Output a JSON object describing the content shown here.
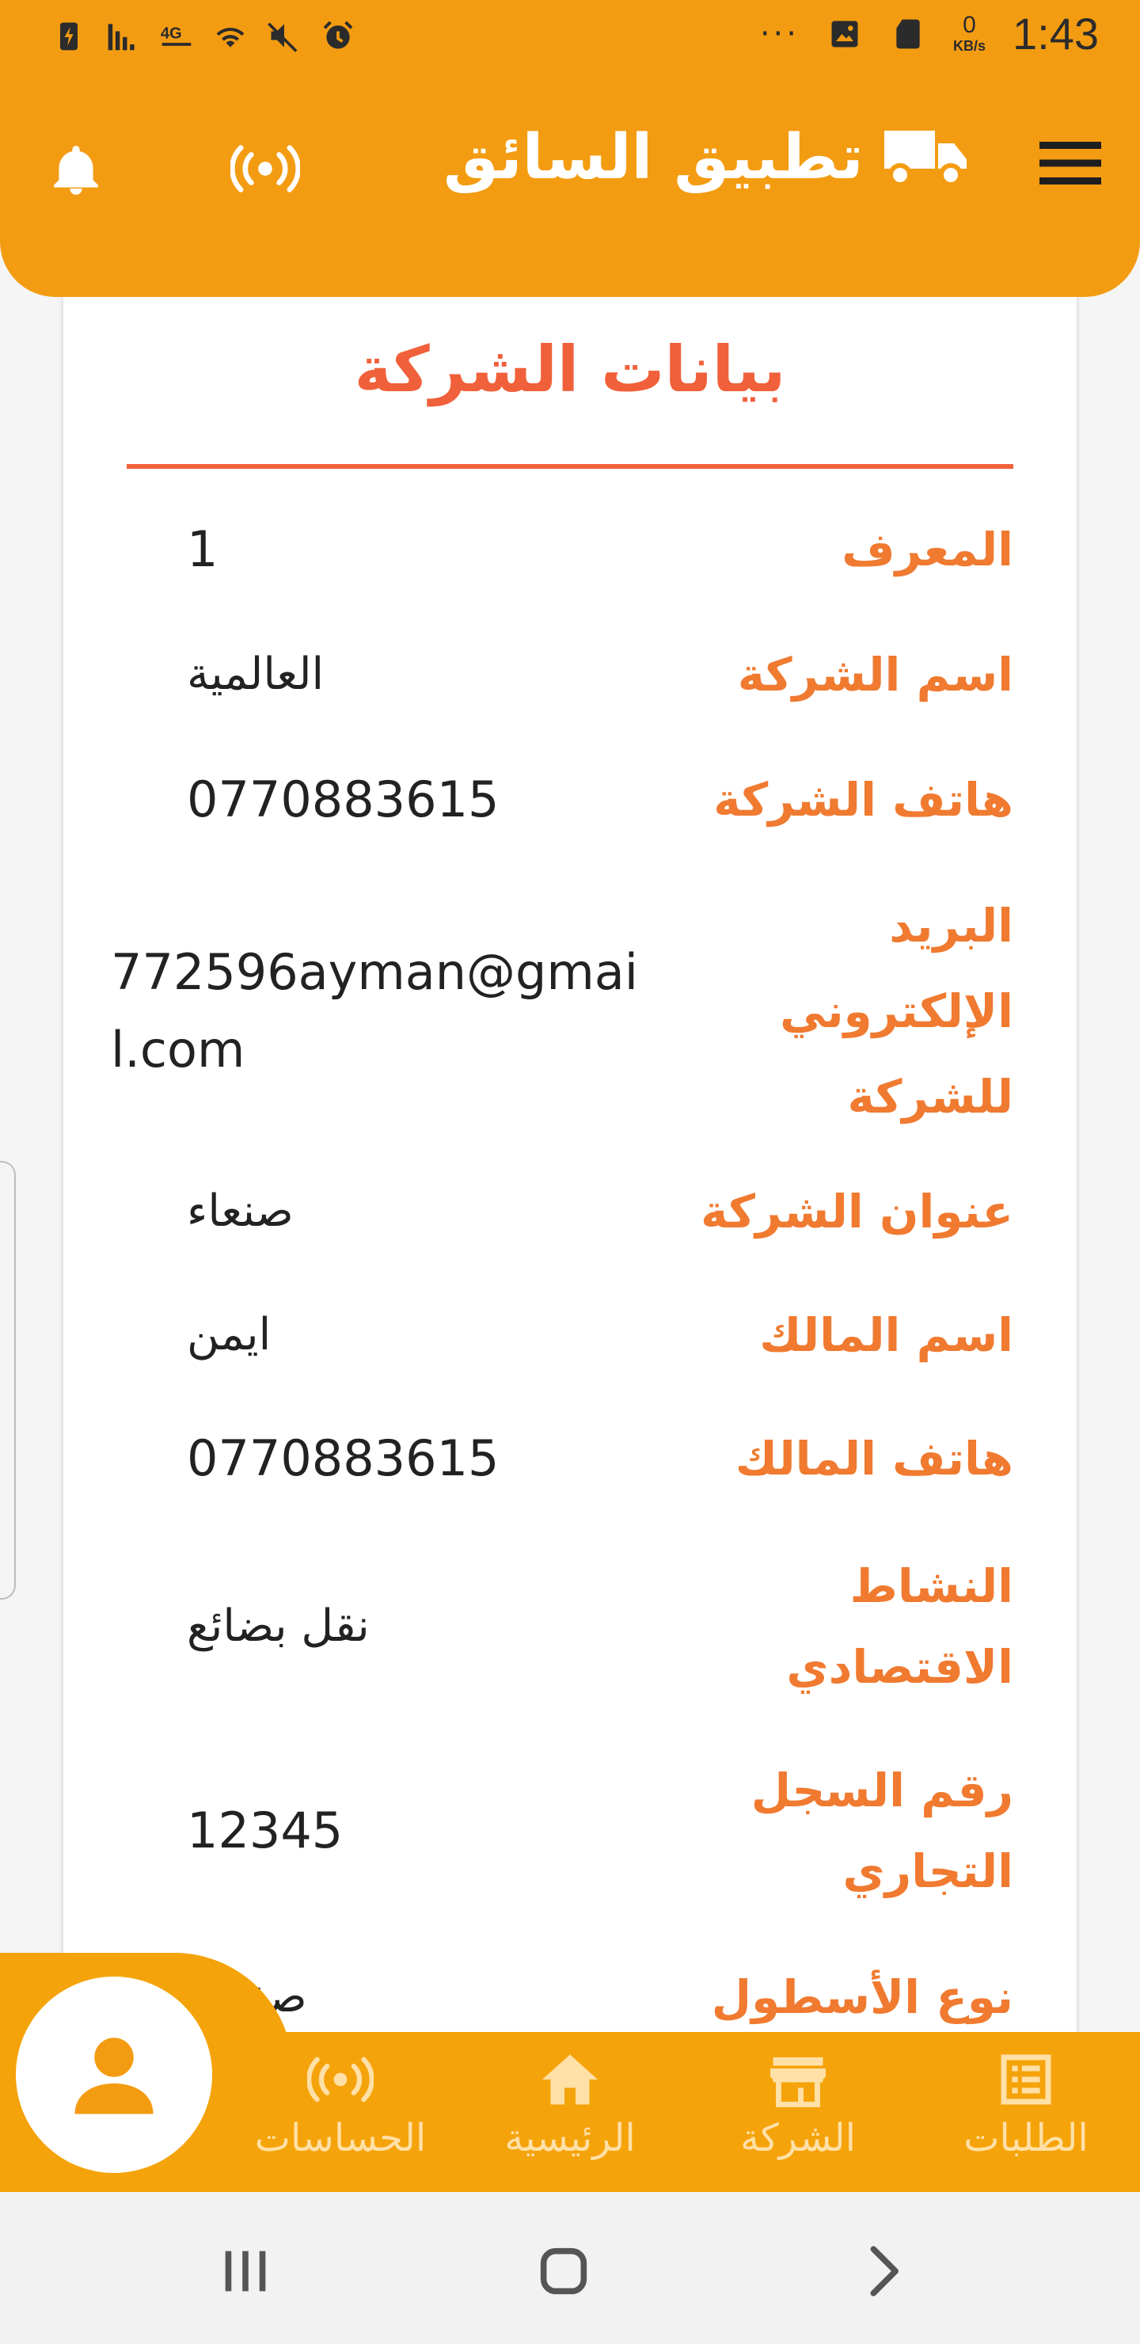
{
  "status_bar": {
    "time": "1:43",
    "more": "···",
    "speed_value": "0",
    "speed_unit": "KB/s"
  },
  "app_bar": {
    "title": "تطبيق السائق"
  },
  "card": {
    "title": "بيانات الشركة",
    "rows": [
      {
        "label": "المعرف",
        "value": "1"
      },
      {
        "label": "اسم الشركة",
        "value": "العالمية"
      },
      {
        "label": "هاتف الشركة",
        "value": "0770883615"
      },
      {
        "label": "البريد الإلكتروني للشركة",
        "value": "772596ayman@gmail.com"
      },
      {
        "label": "عنوان الشركة",
        "value": "صنعاء"
      },
      {
        "label": "اسم المالك",
        "value": "ايمن"
      },
      {
        "label": "هاتف المالك",
        "value": "0770883615"
      },
      {
        "label": "النشاط الاقتصادي",
        "value": "نقل بضائع"
      },
      {
        "label": "رقم السجل التجاري",
        "value": "12345"
      },
      {
        "label": "نوع الأسطول",
        "value": "صغيرة"
      }
    ]
  },
  "bottom_nav": {
    "items": [
      {
        "label": "الطلبات",
        "icon": "orders-icon"
      },
      {
        "label": "الشركة",
        "icon": "store-icon"
      },
      {
        "label": "الرئيسية",
        "icon": "home-icon"
      },
      {
        "label": "الحساسات",
        "icon": "sensors-icon"
      }
    ]
  },
  "colors": {
    "primary": "#f39c12",
    "nav_bg": "#f5a30a",
    "label": "#f07a30",
    "title": "#f0603a"
  }
}
